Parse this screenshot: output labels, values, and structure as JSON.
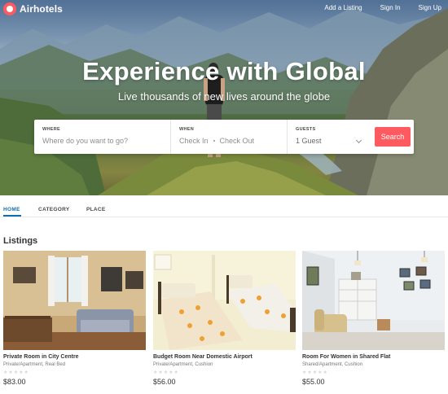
{
  "header": {
    "logo_text": "Airhotels",
    "nav": [
      "Add a Listing",
      "Sign In",
      "Sign Up"
    ]
  },
  "hero": {
    "headline": "Experience with Global",
    "subhead": "Live thousands of new lives around the globe"
  },
  "search": {
    "where_label": "WHERE",
    "where_placeholder": "Where do you want to go?",
    "when_label": "WHEN",
    "check_in": "Check In",
    "check_out": "Check Out",
    "guests_label": "GUESTS",
    "guests_value": "1 Guest",
    "button_label": "Search"
  },
  "tabs": [
    "HOME",
    "CATEGORY",
    "PLACE"
  ],
  "active_tab": "HOME",
  "listings_title": "Listings",
  "listings": [
    {
      "title": "Private Room in City Centre",
      "subtitle": "Private/Apartment, Real Bed",
      "stars": "★★★★★",
      "price": "$83.00"
    },
    {
      "title": "Budget Room Near Domestic Airport",
      "subtitle": "Private/Apartment, Cushion",
      "stars": "★★★★★",
      "price": "$56.00"
    },
    {
      "title": "Room For Women in Shared Flat",
      "subtitle": "Shared/Apartment, Cushion",
      "stars": "★★★★★",
      "price": "$55.00"
    }
  ],
  "colors": {
    "accent": "#ff5a5f",
    "tab_active": "#0f6fa8"
  }
}
